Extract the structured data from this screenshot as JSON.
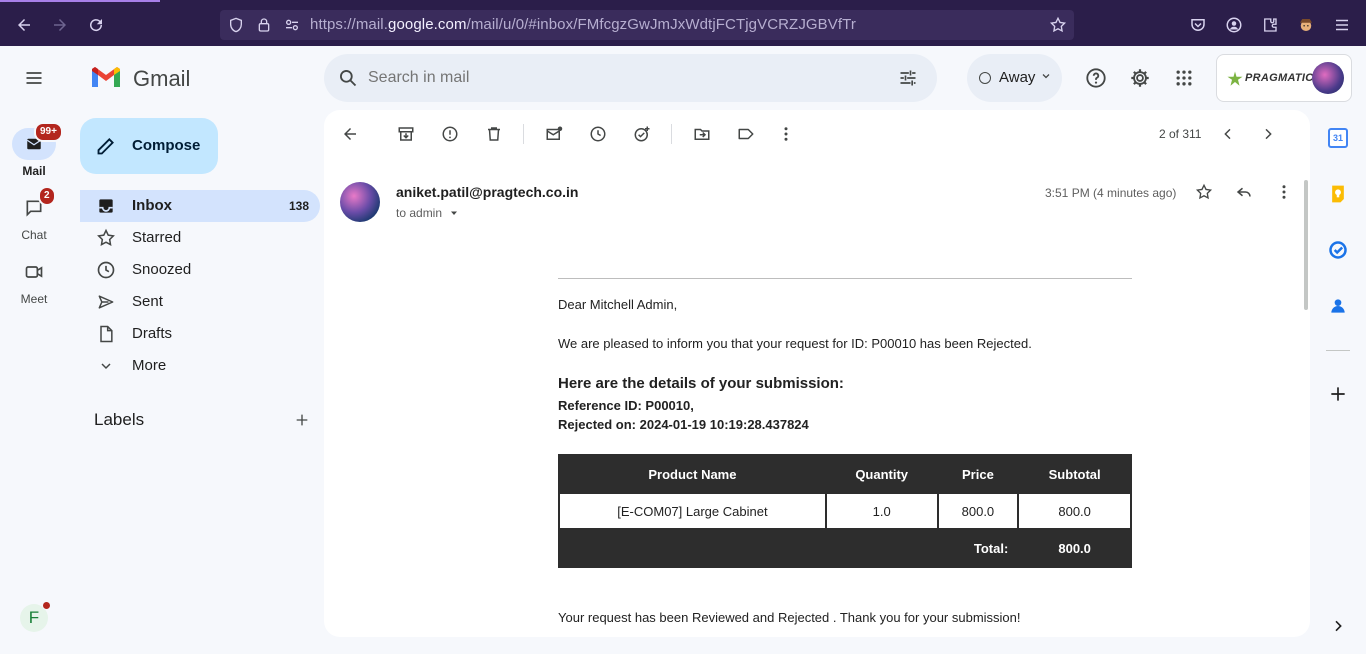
{
  "browser": {
    "url_prefix": "https://mail.",
    "url_domain": "google.com",
    "url_suffix": "/mail/u/0/#inbox/FMfcgzGwJmJxWdtjFCTjgVCRZJGBVfTr"
  },
  "gmail": {
    "logo_text": "Gmail",
    "search_placeholder": "Search in mail",
    "status_label": "Away",
    "org_logo_text": "Pragmatic"
  },
  "rail": {
    "mail_label": "Mail",
    "mail_badge": "99+",
    "chat_label": "Chat",
    "chat_badge": "2",
    "meet_label": "Meet",
    "avatar_letter": "F"
  },
  "sidebar": {
    "compose_label": "Compose",
    "items": [
      {
        "label": "Inbox",
        "count": "138"
      },
      {
        "label": "Starred"
      },
      {
        "label": "Snoozed"
      },
      {
        "label": "Sent"
      },
      {
        "label": "Drafts"
      },
      {
        "label": "More"
      }
    ],
    "labels_heading": "Labels"
  },
  "toolbar": {
    "pagination": "2 of 311"
  },
  "email": {
    "sender": "aniket.patil@pragtech.co.in",
    "to_line": "to admin",
    "time": "3:51 PM (4 minutes ago)",
    "greeting": "Dear Mitchell Admin,",
    "intro": "We are pleased to inform you that your request for ID: P00010 has been Rejected.",
    "details_heading": "Here are the details of your submission:",
    "reference_line": "Reference ID: P00010,",
    "rejected_line": "Rejected on: 2024-01-19 10:19:28.437824",
    "table": {
      "headers": [
        "Product Name",
        "Quantity",
        "Price",
        "Subtotal"
      ],
      "row": [
        "[E-COM07] Large Cabinet",
        "1.0",
        "800.0",
        "800.0"
      ],
      "total_label": "Total:",
      "total_value": "800.0"
    },
    "closing": "Your request has been Reviewed and Rejected . Thank you for your submission!"
  },
  "colors": {
    "browser_bg": "#2b1e4a",
    "compose_bg": "#c2e7ff",
    "inbox_selected_bg": "#d3e3fd",
    "badge_red": "#b3261e",
    "table_dark": "#2d2d2d"
  }
}
